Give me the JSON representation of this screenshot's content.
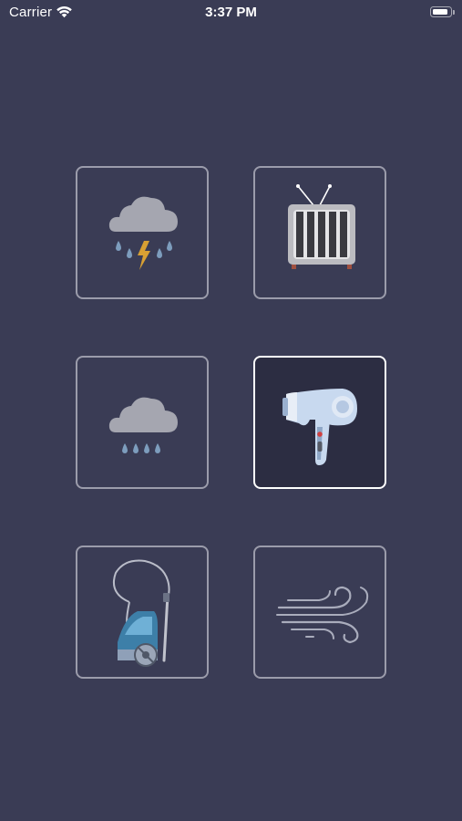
{
  "status_bar": {
    "carrier": "Carrier",
    "time": "3:37 PM",
    "battery_level": 0.8
  },
  "tiles": [
    {
      "icon": "thunderstorm-icon",
      "selected": false
    },
    {
      "icon": "tv-static-icon",
      "selected": false
    },
    {
      "icon": "rain-icon",
      "selected": false
    },
    {
      "icon": "hair-dryer-icon",
      "selected": true
    },
    {
      "icon": "vacuum-cleaner-icon",
      "selected": false
    },
    {
      "icon": "wind-icon",
      "selected": false
    }
  ],
  "colors": {
    "background": "#3a3c55",
    "tile_border": "#9b9cab",
    "tile_selected_border": "#ffffff",
    "tile_selected_background": "#2c2d42"
  }
}
